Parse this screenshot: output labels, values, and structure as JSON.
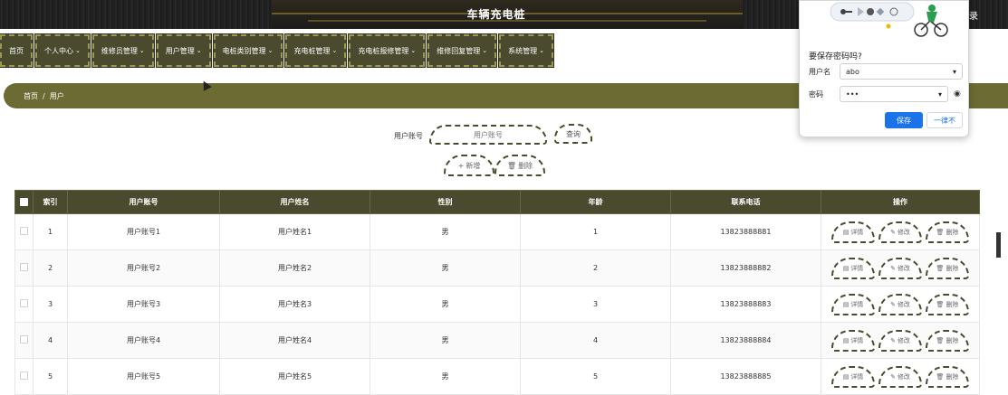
{
  "header": {
    "title": "车辆充电桩",
    "right_link": "录"
  },
  "nav": [
    {
      "label": "首页",
      "caret": ""
    },
    {
      "label": "个人中心",
      "caret": "⌄"
    },
    {
      "label": "维修员管理",
      "caret": "⌄"
    },
    {
      "label": "用户管理",
      "caret": "⌄"
    },
    {
      "label": "电桩类别管理",
      "caret": "⌄"
    },
    {
      "label": "充电桩管理",
      "caret": "⌄"
    },
    {
      "label": "充电桩报修管理",
      "caret": "⌄"
    },
    {
      "label": "维修回复管理",
      "caret": "⌄"
    },
    {
      "label": "系统管理",
      "caret": "⌄"
    }
  ],
  "breadcrumb": {
    "home": "首页",
    "sep": "/",
    "current": "用户"
  },
  "search": {
    "label": "用户账号",
    "placeholder": "用户账号",
    "query_button": "查询"
  },
  "actions": {
    "add_icon": "+",
    "add_label": "新增",
    "delete_icon": "🗑",
    "delete_label": "删除"
  },
  "table": {
    "headers": [
      "索引",
      "用户账号",
      "用户姓名",
      "性别",
      "年龄",
      "联系电话",
      "操作"
    ],
    "rows": [
      {
        "index": "1",
        "account": "用户账号1",
        "name": "用户姓名1",
        "gender": "男",
        "age": "1",
        "phone": "13823888881"
      },
      {
        "index": "2",
        "account": "用户账号2",
        "name": "用户姓名2",
        "gender": "男",
        "age": "2",
        "phone": "13823888882"
      },
      {
        "index": "3",
        "account": "用户账号3",
        "name": "用户姓名3",
        "gender": "男",
        "age": "3",
        "phone": "13823888883"
      },
      {
        "index": "4",
        "account": "用户账号4",
        "name": "用户姓名4",
        "gender": "男",
        "age": "4",
        "phone": "13823888884"
      },
      {
        "index": "5",
        "account": "用户账号5",
        "name": "用户姓名5",
        "gender": "男",
        "age": "5",
        "phone": "13823888885"
      }
    ],
    "row_buttons": {
      "detail": {
        "icon": "▤",
        "label": "详情"
      },
      "edit": {
        "icon": "✎",
        "label": "修改"
      },
      "delete": {
        "icon": "🗑",
        "label": "删除"
      }
    }
  },
  "password_popup": {
    "title": "要保存密码吗?",
    "username_label": "用户名",
    "username_value": "abo",
    "password_label": "密码",
    "password_value": "•••",
    "save_button": "保存",
    "never_button": "一律不"
  },
  "colors": {
    "primary": "#4a4a2e",
    "breadcrumb_bg": "#6b6b33",
    "header_bg": "#1f1f1f",
    "save_blue": "#1a73e8"
  }
}
